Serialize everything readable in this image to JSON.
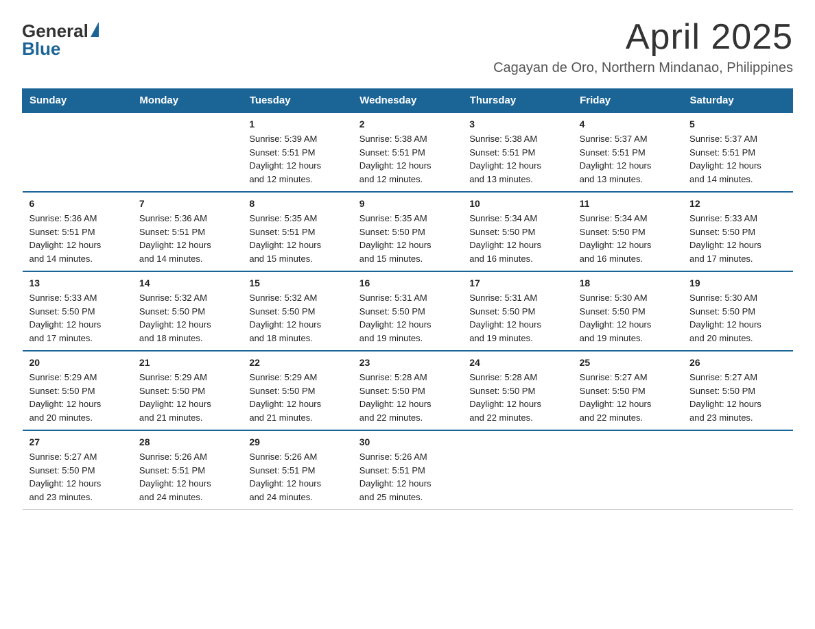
{
  "logo": {
    "general": "General",
    "blue": "Blue"
  },
  "header": {
    "title": "April 2025",
    "subtitle": "Cagayan de Oro, Northern Mindanao, Philippines"
  },
  "calendar": {
    "days_of_week": [
      "Sunday",
      "Monday",
      "Tuesday",
      "Wednesday",
      "Thursday",
      "Friday",
      "Saturday"
    ],
    "weeks": [
      [
        {
          "day": "",
          "info": ""
        },
        {
          "day": "",
          "info": ""
        },
        {
          "day": "1",
          "info": "Sunrise: 5:39 AM\nSunset: 5:51 PM\nDaylight: 12 hours\nand 12 minutes."
        },
        {
          "day": "2",
          "info": "Sunrise: 5:38 AM\nSunset: 5:51 PM\nDaylight: 12 hours\nand 12 minutes."
        },
        {
          "day": "3",
          "info": "Sunrise: 5:38 AM\nSunset: 5:51 PM\nDaylight: 12 hours\nand 13 minutes."
        },
        {
          "day": "4",
          "info": "Sunrise: 5:37 AM\nSunset: 5:51 PM\nDaylight: 12 hours\nand 13 minutes."
        },
        {
          "day": "5",
          "info": "Sunrise: 5:37 AM\nSunset: 5:51 PM\nDaylight: 12 hours\nand 14 minutes."
        }
      ],
      [
        {
          "day": "6",
          "info": "Sunrise: 5:36 AM\nSunset: 5:51 PM\nDaylight: 12 hours\nand 14 minutes."
        },
        {
          "day": "7",
          "info": "Sunrise: 5:36 AM\nSunset: 5:51 PM\nDaylight: 12 hours\nand 14 minutes."
        },
        {
          "day": "8",
          "info": "Sunrise: 5:35 AM\nSunset: 5:51 PM\nDaylight: 12 hours\nand 15 minutes."
        },
        {
          "day": "9",
          "info": "Sunrise: 5:35 AM\nSunset: 5:50 PM\nDaylight: 12 hours\nand 15 minutes."
        },
        {
          "day": "10",
          "info": "Sunrise: 5:34 AM\nSunset: 5:50 PM\nDaylight: 12 hours\nand 16 minutes."
        },
        {
          "day": "11",
          "info": "Sunrise: 5:34 AM\nSunset: 5:50 PM\nDaylight: 12 hours\nand 16 minutes."
        },
        {
          "day": "12",
          "info": "Sunrise: 5:33 AM\nSunset: 5:50 PM\nDaylight: 12 hours\nand 17 minutes."
        }
      ],
      [
        {
          "day": "13",
          "info": "Sunrise: 5:33 AM\nSunset: 5:50 PM\nDaylight: 12 hours\nand 17 minutes."
        },
        {
          "day": "14",
          "info": "Sunrise: 5:32 AM\nSunset: 5:50 PM\nDaylight: 12 hours\nand 18 minutes."
        },
        {
          "day": "15",
          "info": "Sunrise: 5:32 AM\nSunset: 5:50 PM\nDaylight: 12 hours\nand 18 minutes."
        },
        {
          "day": "16",
          "info": "Sunrise: 5:31 AM\nSunset: 5:50 PM\nDaylight: 12 hours\nand 19 minutes."
        },
        {
          "day": "17",
          "info": "Sunrise: 5:31 AM\nSunset: 5:50 PM\nDaylight: 12 hours\nand 19 minutes."
        },
        {
          "day": "18",
          "info": "Sunrise: 5:30 AM\nSunset: 5:50 PM\nDaylight: 12 hours\nand 19 minutes."
        },
        {
          "day": "19",
          "info": "Sunrise: 5:30 AM\nSunset: 5:50 PM\nDaylight: 12 hours\nand 20 minutes."
        }
      ],
      [
        {
          "day": "20",
          "info": "Sunrise: 5:29 AM\nSunset: 5:50 PM\nDaylight: 12 hours\nand 20 minutes."
        },
        {
          "day": "21",
          "info": "Sunrise: 5:29 AM\nSunset: 5:50 PM\nDaylight: 12 hours\nand 21 minutes."
        },
        {
          "day": "22",
          "info": "Sunrise: 5:29 AM\nSunset: 5:50 PM\nDaylight: 12 hours\nand 21 minutes."
        },
        {
          "day": "23",
          "info": "Sunrise: 5:28 AM\nSunset: 5:50 PM\nDaylight: 12 hours\nand 22 minutes."
        },
        {
          "day": "24",
          "info": "Sunrise: 5:28 AM\nSunset: 5:50 PM\nDaylight: 12 hours\nand 22 minutes."
        },
        {
          "day": "25",
          "info": "Sunrise: 5:27 AM\nSunset: 5:50 PM\nDaylight: 12 hours\nand 22 minutes."
        },
        {
          "day": "26",
          "info": "Sunrise: 5:27 AM\nSunset: 5:50 PM\nDaylight: 12 hours\nand 23 minutes."
        }
      ],
      [
        {
          "day": "27",
          "info": "Sunrise: 5:27 AM\nSunset: 5:50 PM\nDaylight: 12 hours\nand 23 minutes."
        },
        {
          "day": "28",
          "info": "Sunrise: 5:26 AM\nSunset: 5:51 PM\nDaylight: 12 hours\nand 24 minutes."
        },
        {
          "day": "29",
          "info": "Sunrise: 5:26 AM\nSunset: 5:51 PM\nDaylight: 12 hours\nand 24 minutes."
        },
        {
          "day": "30",
          "info": "Sunrise: 5:26 AM\nSunset: 5:51 PM\nDaylight: 12 hours\nand 25 minutes."
        },
        {
          "day": "",
          "info": ""
        },
        {
          "day": "",
          "info": ""
        },
        {
          "day": "",
          "info": ""
        }
      ]
    ]
  }
}
